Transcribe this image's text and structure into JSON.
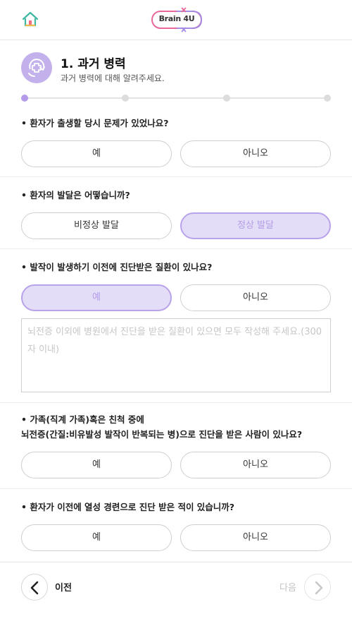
{
  "header": {
    "home_icon": "home-icon",
    "logo_text": "Brain 4U"
  },
  "step": {
    "icon": "medical-history-icon",
    "title": "1. 과거 병력",
    "subtitle": "과거 병력에 대해 알려주세요.",
    "progress": {
      "current": 1,
      "total": 4
    }
  },
  "questions": [
    {
      "text": "• 환자가 출생할 당시 문제가 있었나요?",
      "options": [
        "예",
        "아니오"
      ],
      "selected": null
    },
    {
      "text": "• 환자의 발달은 어떻습니까?",
      "options": [
        "비정상 발달",
        "정상 발달"
      ],
      "selected": 1
    },
    {
      "text": "• 발작이 발생하기 이전에 진단받은 질환이 있나요?",
      "options": [
        "예",
        "아니오"
      ],
      "selected": 0,
      "textarea": {
        "value": "",
        "placeholder": "뇌전증 이외에 병원에서 진단을 받은 질환이 있으면 모두 작성해 주세요.(300자 이내)"
      }
    },
    {
      "text_line1": "• 가족(직계 가족)혹은 친척 중에",
      "text_line2": "뇌전증(간질:비유발성 발작이 반복되는 병)으로 진단을 받은 사람이 있나요?",
      "options": [
        "예",
        "아니오"
      ],
      "selected": null
    },
    {
      "text": "• 환자가 이전에 열성 경련으로 진단 받은 적이 있습니까?",
      "options": [
        "예",
        "아니오"
      ],
      "selected": null
    }
  ],
  "footer": {
    "prev_label": "이전",
    "next_label": "다음",
    "prev_icon": "chevron-left-icon",
    "next_icon": "chevron-right-icon"
  },
  "colors": {
    "accent": "#b49ae8",
    "selected_bg": "#e4ddf7",
    "logo_pink": "#e8679a",
    "logo_purple": "#a58be2",
    "home_green": "#3fb8a3",
    "home_red": "#ef6f7f"
  }
}
